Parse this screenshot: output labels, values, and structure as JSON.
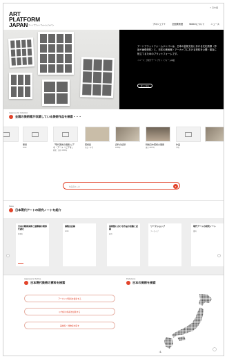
{
  "header": {
    "lang": "≡ 日本語",
    "logo_lines": [
      "ART",
      "PLATFORM",
      "JAPAN"
    ],
    "tagline": "アートプラットフォームジャパン",
    "nav": [
      "プロジェクト",
      "全国美術館",
      "NMAOについて",
      "ニュース"
    ]
  },
  "hero": {
    "text": "アートプラットフォームジャパンは、日本の芸術文化における文化資源（作品や画像資料）と、日本の美術館・アーカイブにおける資料を公開・普及に役立てるためのプラットフォームです。",
    "subtext": "イメージ：文化庁アートプラットフォーム事業",
    "button": "詳しく見る"
  },
  "section_collection": {
    "en": "Japanese Art Collection",
    "title": "全国の美術館が収蔵している美術作品を検索・・・",
    "books": [
      {
        "title": "無題",
        "meta": "2019"
      },
      {
        "title": "「現代美術の展開 ビデオ・アート・ビデオ」",
        "meta": "著者：田中\n2000年"
      },
      {
        "title": "美術館",
        "meta": "作品・年代"
      },
      {
        "title": "資料の記録",
        "meta": "1988年"
      },
      {
        "title": "戦後日本美術の展開",
        "meta": "東京\n2015年"
      },
      {
        "title": "作品",
        "meta": "不明"
      }
    ],
    "search_placeholder": "作品名を入力"
  },
  "section_notes": {
    "en": "Notes",
    "title": "日本現代アートの研究ノートを紹介",
    "cards": [
      {
        "title": "日本の戦後美術と国際展の関係を読む",
        "meta": "筆者名"
      },
      {
        "title": "展覧会記録",
        "meta": "2018"
      },
      {
        "title": "美術館における作品の収集と記録",
        "meta": "研究"
      },
      {
        "title": "ワークショップ",
        "meta": "アーカイブ"
      },
      {
        "title": "現代アートの研究ノート",
        "meta": "資料"
      }
    ]
  },
  "section_archive": {
    "en": "Japanese Art Archive",
    "title": "日本現代美術の資料を検索",
    "buttons": [
      "アーカイブ資料を検索する",
      "Q 作家の情報を検索する",
      "美術館・博物館を探す"
    ]
  },
  "section_map": {
    "en": "Prefectures",
    "title": "日本の美術を検索"
  },
  "colors": {
    "accent": "#e2432a",
    "hero_bg": "#000000"
  }
}
